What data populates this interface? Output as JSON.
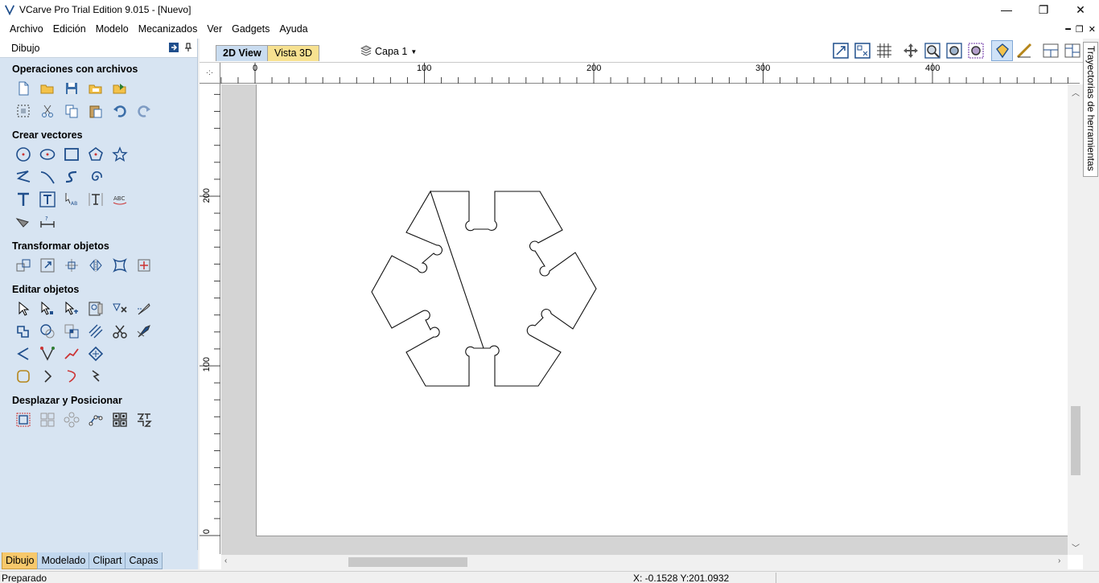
{
  "window": {
    "title": "VCarve Pro Trial Edition 9.015 - [Nuevo]",
    "controls": {
      "minimize": "—",
      "restore": "❐",
      "close": "✕"
    }
  },
  "menubar": {
    "items": [
      "Archivo",
      "Edición",
      "Modelo",
      "Mecanizados",
      "Ver",
      "Gadgets",
      "Ayuda"
    ]
  },
  "left_panel": {
    "header": "Dibujo",
    "sections": {
      "files": "Operaciones con archivos",
      "create": "Crear vectores",
      "transform": "Transformar objetos",
      "edit": "Editar objetos",
      "move": "Desplazar y Posicionar"
    },
    "tabs": [
      "Dibujo",
      "Modelado",
      "Clipart",
      "Capas"
    ]
  },
  "view_tabs": {
    "tab_2d": "2D View",
    "tab_3d": "Vista 3D"
  },
  "layer": {
    "selected": "Capa 1"
  },
  "rulers": {
    "h_labels": [
      "0",
      "100",
      "200",
      "300",
      "400"
    ],
    "v_labels": [
      "200",
      "100",
      "0"
    ]
  },
  "right_tab": {
    "label": "Trayectorias de herramientas"
  },
  "status": {
    "left": "Preparado",
    "coords": "X: -0.1528 Y:201.0932"
  },
  "colors": {
    "panel_bg": "#d7e4f2",
    "active_tab": "#f7c86b",
    "accent_blue": "#1f4e8c"
  }
}
